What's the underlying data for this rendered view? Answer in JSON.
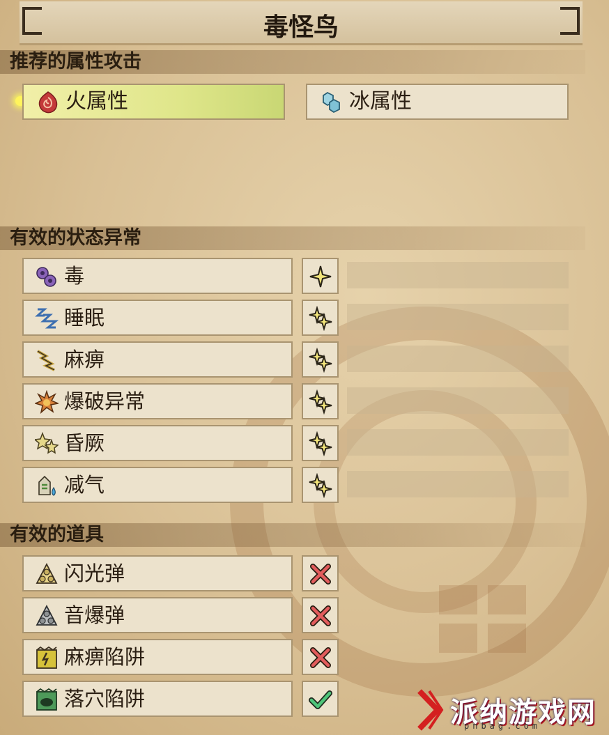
{
  "title": "毒怪鸟",
  "sections": {
    "elements": "推荐的属性攻击",
    "status": "有效的状态异常",
    "items": "有效的道具"
  },
  "elements": [
    {
      "label": "火属性",
      "icon": "fire-icon",
      "highlighted": true
    },
    {
      "label": "冰属性",
      "icon": "ice-icon",
      "highlighted": false
    }
  ],
  "status_ailments": [
    {
      "label": "毒",
      "icon": "poison-icon",
      "rating": 1
    },
    {
      "label": "睡眠",
      "icon": "sleep-icon",
      "rating": 2
    },
    {
      "label": "麻痹",
      "icon": "paralysis-icon",
      "rating": 2
    },
    {
      "label": "爆破异常",
      "icon": "blast-icon",
      "rating": 2
    },
    {
      "label": "昏厥",
      "icon": "stun-icon",
      "rating": 2
    },
    {
      "label": "减气",
      "icon": "exhaust-icon",
      "rating": 2
    }
  ],
  "items": [
    {
      "label": "闪光弹",
      "icon": "flash-pod-icon",
      "effective": false
    },
    {
      "label": "音爆弹",
      "icon": "screamer-pod-icon",
      "effective": false
    },
    {
      "label": "麻痹陷阱",
      "icon": "shock-trap-icon",
      "effective": false
    },
    {
      "label": "落穴陷阱",
      "icon": "pitfall-trap-icon",
      "effective": true
    }
  ],
  "colors": {
    "highlight": "#dfe68a",
    "star": "#f3e57a",
    "cross": "#e25c5c",
    "check": "#4fc57a"
  },
  "watermark": {
    "cn": "派纳游戏网",
    "en": "pnbag.com"
  }
}
